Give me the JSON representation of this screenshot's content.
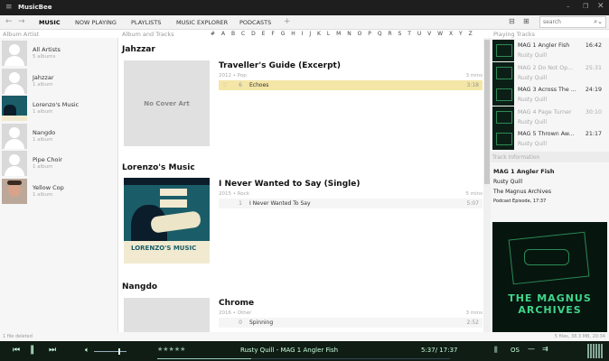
{
  "app": {
    "title": "MusicBee"
  },
  "tabs": [
    "MUSIC",
    "NOW PLAYING",
    "PLAYLISTS",
    "MUSIC EXPLORER",
    "PODCASTS",
    "+"
  ],
  "search": {
    "placeholder": "search"
  },
  "left": {
    "header": "Album Artist",
    "artists": [
      {
        "name": "All Artists",
        "count": "5 albums"
      },
      {
        "name": "Jahzzar",
        "count": "1 album"
      },
      {
        "name": "Lorenzo's Music",
        "count": "1 album"
      },
      {
        "name": "Nangdo",
        "count": "1 album"
      },
      {
        "name": "Pipe Choir",
        "count": "1 album"
      },
      {
        "name": "Yellow Cop",
        "count": "1 album"
      }
    ]
  },
  "center": {
    "header": "Album and Tracks",
    "letters": [
      "#",
      "A",
      "B",
      "C",
      "D",
      "E",
      "F",
      "G",
      "H",
      "I",
      "J",
      "K",
      "L",
      "M",
      "N",
      "O",
      "P",
      "Q",
      "R",
      "S",
      "T",
      "U",
      "V",
      "W",
      "X",
      "Y",
      "Z"
    ],
    "groups": [
      {
        "artist": "Jahzzar",
        "cover": "No Cover Art",
        "album": "Traveller's Guide (Excerpt)",
        "meta": "2012 • Pop",
        "length": "3 mins",
        "tracks": [
          {
            "no": "6",
            "title": "Echoes",
            "dur": "3:18",
            "selected": true
          }
        ]
      },
      {
        "artist": "Lorenzo's Music",
        "cover": "LORENZO'S MUSIC",
        "album": "I Never Wanted to Say (Single)",
        "meta": "2015 • Rock",
        "length": "5 mins",
        "tracks": [
          {
            "no": "1",
            "title": "I Never Wanted To Say",
            "dur": "5:07"
          }
        ]
      },
      {
        "artist": "Nangdo",
        "album": "Chrome",
        "meta": "2016 • Other",
        "length": "3 mins",
        "tracks": [
          {
            "no": "0",
            "title": "Spinning",
            "dur": "2:52"
          }
        ]
      }
    ]
  },
  "right": {
    "header": "Playing Tracks",
    "tracks": [
      {
        "title": "MAG 1 Angler Fish",
        "artist": "Rusty Quill",
        "dur": "16:42"
      },
      {
        "title": "MAG 2 Do Not Op...",
        "artist": "Rusty Quill",
        "dur": "25:31"
      },
      {
        "title": "MAG 3 Across The ...",
        "artist": "Rusty Quill",
        "dur": "24:19"
      },
      {
        "title": "MAG 4 Page Turner",
        "artist": "Rusty Quill",
        "dur": "30:10"
      },
      {
        "title": "MAG 5 Thrown Aw...",
        "artist": "Rusty Quill",
        "dur": "21:17"
      }
    ],
    "info_header": "Track Information",
    "info": {
      "title": "MAG 1 Angler Fish",
      "artist": "Rusty Quill",
      "album": "The Magnus Archives",
      "detail": "Podcast Episode, 17:37"
    },
    "art_text": "THE MAGNUS ARCHIVES"
  },
  "status": {
    "left": "1 file deleted",
    "right": "5 files, 38.3 MB, 20:34"
  },
  "player": {
    "rating": "★★★★★",
    "now_playing": "Rusty Quill - MAG 1 Angler Fish",
    "time": "5:37/ 17:37",
    "progress": 0.32,
    "volume": 0.75
  },
  "colors": {
    "player_bg": "#0f1d15",
    "selected_row": "#f3e6a6"
  }
}
